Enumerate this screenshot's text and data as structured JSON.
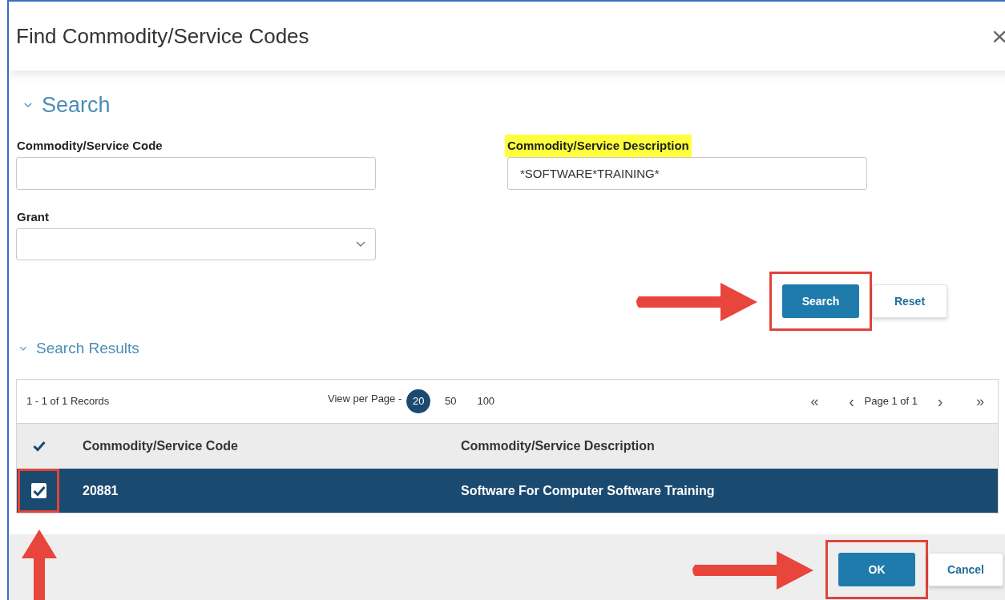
{
  "dialog": {
    "title": "Find Commodity/Service Codes",
    "close": "×"
  },
  "search_section": {
    "heading": "Search",
    "expanded": true,
    "fields": [
      {
        "label": "Commodity/Service Code",
        "kind": "text",
        "highlighted": false
      },
      {
        "label": "Commodity/Service Description",
        "kind": "text",
        "value": "*SOFTWARE*TRAINING*",
        "highlighted": true
      },
      {
        "label": "Grant",
        "kind": "select",
        "highlighted": false
      }
    ],
    "buttons": [
      {
        "label": "Search",
        "primary": true,
        "annotated": true
      },
      {
        "label": "Reset",
        "primary": false,
        "annotated": false
      }
    ]
  },
  "results_section": {
    "heading": "Search Results",
    "expanded": true,
    "record_count": "1 - 1 of 1 Records",
    "view_per_page_label": "View per Page -",
    "page_sizes": [
      {
        "label": "20",
        "selected": true
      },
      {
        "label": "50",
        "selected": false
      },
      {
        "label": "100",
        "selected": false
      }
    ],
    "pagination": {
      "first": "«",
      "prev": "‹",
      "page": "Page 1 of 1",
      "next": "›",
      "last": "»"
    },
    "table": {
      "select_all_checked": true,
      "columns": [
        "Commodity/Service Code",
        "Commodity/Service Description"
      ],
      "rows": [
        {
          "cells": [
            "20881",
            "Software For Computer Software Training"
          ],
          "selected": true,
          "checked": true,
          "annotated": true
        }
      ]
    }
  },
  "footer_buttons": [
    {
      "label": "OK",
      "primary": true,
      "annotated": true
    },
    {
      "label": "Cancel",
      "primary": false,
      "annotated": false
    }
  ]
}
